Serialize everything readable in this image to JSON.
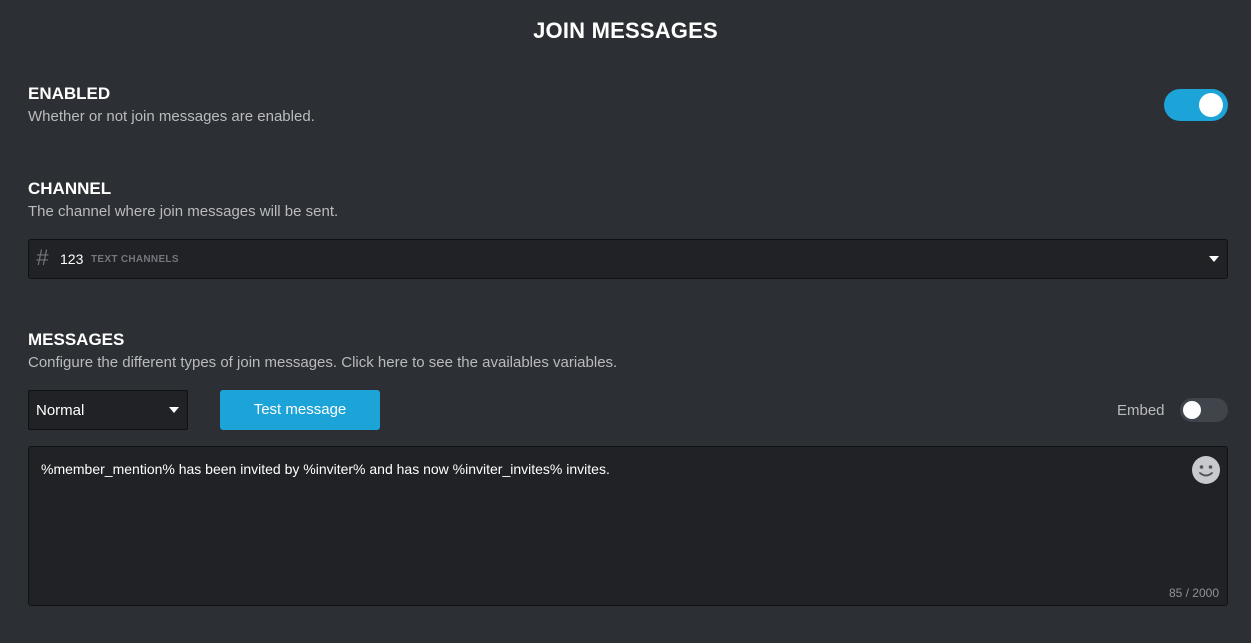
{
  "page": {
    "title": "JOIN MESSAGES"
  },
  "enabled": {
    "title": "ENABLED",
    "description": "Whether or not join messages are enabled.",
    "value": true
  },
  "channel": {
    "title": "CHANNEL",
    "description": "The channel where join messages will be sent.",
    "selected_name": "123",
    "selected_category": "TEXT CHANNELS",
    "icon": "hash-icon"
  },
  "messages": {
    "title": "MESSAGES",
    "description": "Configure the different types of join messages. Click here to see the availables variables.",
    "type_selected": "Normal",
    "test_button_label": "Test message",
    "embed_label": "Embed",
    "embed_enabled": false,
    "message_text": "%member_mention% has been invited by %inviter% and has now %inviter_invites% invites.",
    "char_count": "85 / 2000",
    "emoji_icon": "smiley-icon"
  },
  "colors": {
    "background": "#2c2f33",
    "input_background": "#202225",
    "accent": "#1ca3d8"
  }
}
